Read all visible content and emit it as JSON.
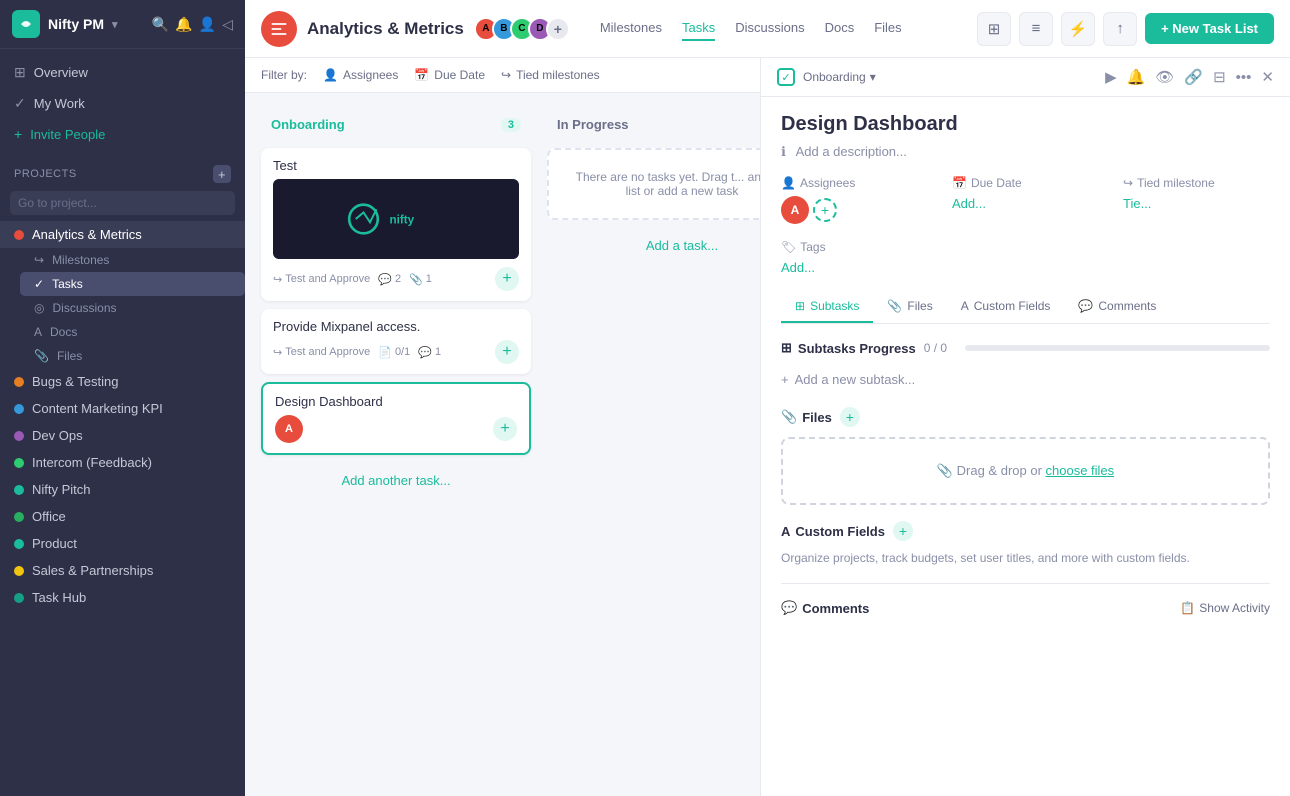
{
  "app": {
    "name": "Nifty PM",
    "chevron": "▾"
  },
  "sidebar": {
    "nav": [
      {
        "id": "overview",
        "label": "Overview",
        "icon": "⊞"
      },
      {
        "id": "my-work",
        "label": "My Work",
        "icon": "✓"
      },
      {
        "id": "invite-people",
        "label": "Invite People",
        "icon": "+"
      }
    ],
    "projects_label": "PROJECTS",
    "search_placeholder": "Go to project...",
    "projects": [
      {
        "id": "analytics",
        "label": "Analytics & Metrics",
        "color": "#e74c3c",
        "active": true
      },
      {
        "id": "bugs",
        "label": "Bugs & Testing",
        "color": "#e67e22"
      },
      {
        "id": "content",
        "label": "Content Marketing KPI",
        "color": "#3498db"
      },
      {
        "id": "devops",
        "label": "Dev Ops",
        "color": "#9b59b6"
      },
      {
        "id": "intercom",
        "label": "Intercom (Feedback)",
        "color": "#2ecc71"
      },
      {
        "id": "pitch",
        "label": "Nifty Pitch",
        "color": "#1abc9c"
      },
      {
        "id": "office",
        "label": "Office",
        "color": "#27ae60"
      },
      {
        "id": "product",
        "label": "Product",
        "color": "#1abc9c"
      },
      {
        "id": "sales",
        "label": "Sales & Partnerships",
        "color": "#f1c40f"
      },
      {
        "id": "taskhub",
        "label": "Task Hub",
        "color": "#16a085"
      }
    ],
    "sub_items": [
      {
        "id": "milestones",
        "label": "Milestones",
        "icon": "↪"
      },
      {
        "id": "tasks",
        "label": "Tasks",
        "icon": "✓",
        "active": true
      },
      {
        "id": "discussions",
        "label": "Discussions",
        "icon": "◎"
      },
      {
        "id": "docs",
        "label": "Docs",
        "icon": "A"
      },
      {
        "id": "files",
        "label": "Files",
        "icon": "🔗"
      }
    ]
  },
  "topbar": {
    "project_name": "Analytics & Metrics",
    "nav_items": [
      "Milestones",
      "Tasks",
      "Discussions",
      "Docs",
      "Files"
    ],
    "active_nav": "Tasks",
    "new_task_label": "+ New Task List"
  },
  "filter_bar": {
    "label": "Filter by:",
    "filters": [
      "Assignees",
      "Due Date",
      "Tied milestones"
    ]
  },
  "columns": [
    {
      "id": "onboarding",
      "title": "Onboarding",
      "count": 3,
      "color": "#1abc9c",
      "tasks": [
        {
          "id": "t1",
          "title": "Test",
          "has_image": true,
          "subtask_label": "Test and Approve",
          "comments": 2,
          "attachments": 1,
          "selected": false
        },
        {
          "id": "t2",
          "title": "Provide  Mixpanel access.",
          "subtask_label": "Test and Approve",
          "doc_progress": "0/1",
          "comments": 1,
          "selected": false
        },
        {
          "id": "t3",
          "title": "Design Dashboard",
          "has_avatar": true,
          "selected": true
        }
      ],
      "add_task_label": "Add another task..."
    },
    {
      "id": "in-progress",
      "title": "In Progress",
      "count": null,
      "color": "#6b6f88",
      "empty_msg": "There are no tasks yet. Drag t... another list or add a new task",
      "add_task_label": "Add a task..."
    }
  ],
  "detail_panel": {
    "breadcrumb": "Onboarding",
    "breadcrumb_chevron": "▾",
    "title": "Design Dashboard",
    "desc_placeholder": "Add a description...",
    "fields": {
      "assignees_label": "Assignees",
      "due_date_label": "Due Date",
      "due_date_add": "Add...",
      "tied_milestone_label": "Tied milestone",
      "tied_milestone_add": "Tie...",
      "tags_label": "Tags",
      "tags_add": "Add..."
    },
    "tabs": [
      {
        "id": "subtasks",
        "label": "Subtasks",
        "icon": "⊞"
      },
      {
        "id": "files",
        "label": "Files",
        "icon": "🔗"
      },
      {
        "id": "custom-fields",
        "label": "Custom Fields",
        "icon": "A"
      },
      {
        "id": "comments",
        "label": "Comments",
        "icon": "💬"
      }
    ],
    "subtasks": {
      "title": "Subtasks Progress",
      "progress": "0 / 0",
      "progress_pct": 0,
      "add_label": "Add a new subtask..."
    },
    "files": {
      "title": "Files",
      "drop_text": "Drag & drop or ",
      "drop_link": "choose files"
    },
    "custom_fields": {
      "title": "Custom Fields",
      "desc": "Organize projects, track budgets, set user titles, and more with custom fields."
    },
    "comments": {
      "title": "Comments",
      "show_activity": "Show Activity"
    }
  }
}
